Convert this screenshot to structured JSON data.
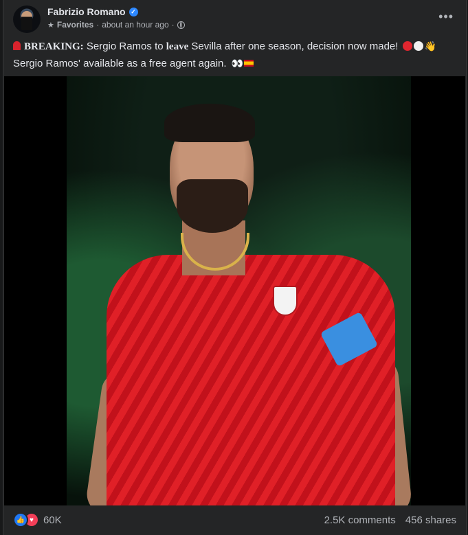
{
  "post": {
    "author": "Fabrizio Romano",
    "audience": "Favorites",
    "timestamp": "about an hour ago",
    "headline_bold": "BREAKING:",
    "headline_part1": "Sergio Ramos to",
    "headline_emph": "leave",
    "headline_part2": "Sevilla after one season, decision now made!",
    "line2": "Sergio Ramos' available as a free agent again.",
    "more_label": "•••"
  },
  "reactions": {
    "count": "60K",
    "comments": "2.5K comments",
    "shares": "456 shares",
    "icons": [
      "like-icon",
      "love-icon"
    ]
  },
  "colors": {
    "background": "#18191a",
    "card": "#242526",
    "text": "#e4e6eb",
    "secondary": "#b0b3b8",
    "verified": "#2d88ff",
    "like": "#2078f4",
    "love": "#f33e58"
  }
}
